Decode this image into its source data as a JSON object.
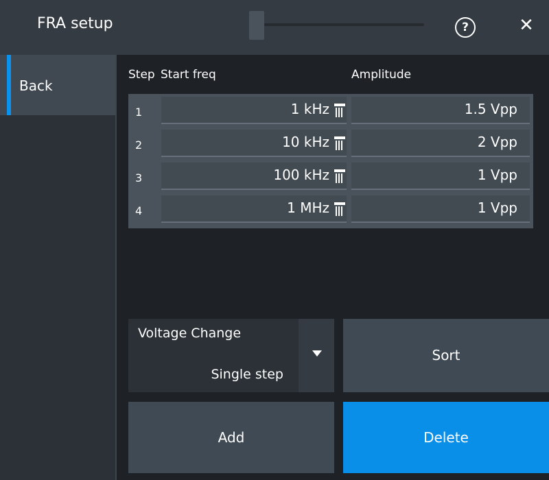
{
  "header": {
    "title": "FRA setup",
    "help_icon": "?",
    "close_icon": "✕"
  },
  "sidebar": {
    "back_label": "Back"
  },
  "table": {
    "columns": [
      "Step",
      "Start freq",
      "Amplitude"
    ],
    "rows": [
      {
        "step": "1",
        "start_freq": "1 kHz",
        "amplitude": "1.5 Vpp"
      },
      {
        "step": "2",
        "start_freq": "10 kHz",
        "amplitude": "2 Vpp"
      },
      {
        "step": "3",
        "start_freq": "100 kHz",
        "amplitude": "1 Vpp"
      },
      {
        "step": "4",
        "start_freq": "1 MHz",
        "amplitude": "1 Vpp"
      }
    ]
  },
  "voltage_change": {
    "label": "Voltage Change",
    "value": "Single step"
  },
  "buttons": {
    "sort": "Sort",
    "add": "Add",
    "delete": "Delete"
  },
  "colors": {
    "accent": "#0a92f0",
    "delete_button": "#0a8fe8"
  }
}
